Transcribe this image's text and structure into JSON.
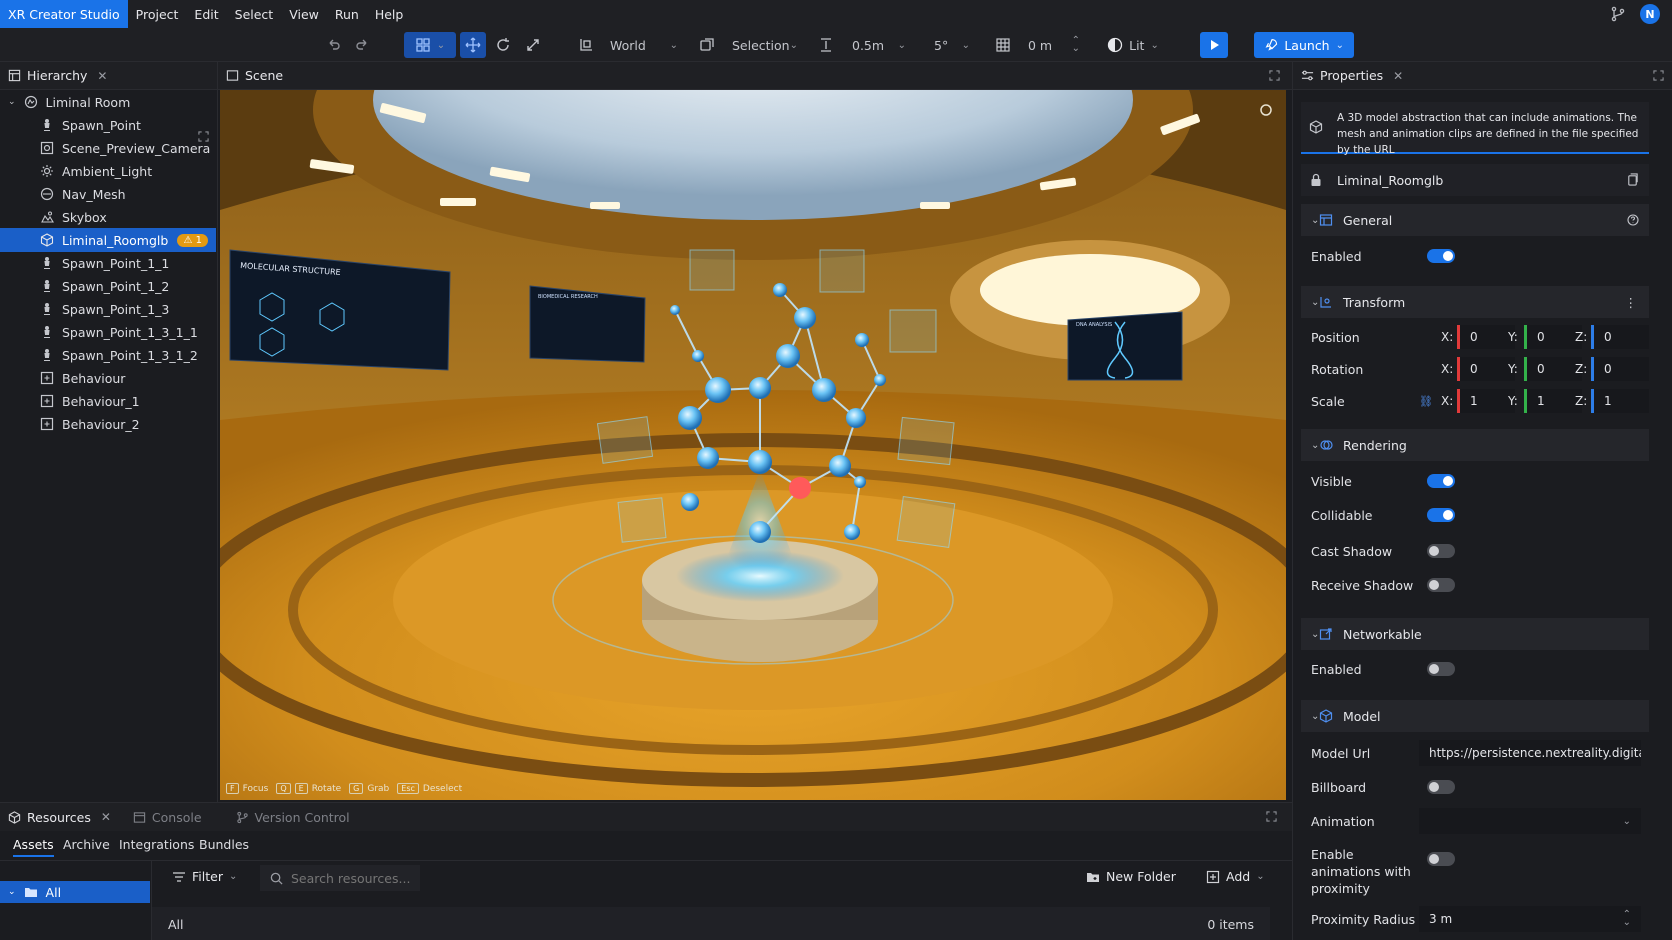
{
  "menubar": {
    "app_title": "XR Creator Studio",
    "items": [
      "Project",
      "Edit",
      "Select",
      "View",
      "Run",
      "Help"
    ],
    "avatar_initial": "N"
  },
  "toolbar": {
    "space_label": "World",
    "selection_label": "Selection",
    "translate_snap": "0.5m",
    "rotate_snap": "5°",
    "grid_height": "0 m",
    "render_mode": "Lit",
    "launch_label": "Launch"
  },
  "hierarchy": {
    "tab_label": "Hierarchy",
    "root": "Liminal Room",
    "items": [
      {
        "label": "Spawn_Point",
        "icon": "spawn-icon"
      },
      {
        "label": "Scene_Preview_Camera",
        "icon": "camera-icon"
      },
      {
        "label": "Ambient_Light",
        "icon": "sun-icon"
      },
      {
        "label": "Nav_Mesh",
        "icon": "navmesh-icon"
      },
      {
        "label": "Skybox",
        "icon": "skybox-icon"
      },
      {
        "label": "Liminal_Roomglb",
        "icon": "model-icon",
        "selected": true,
        "badge": "1"
      },
      {
        "label": "Spawn_Point_1_1",
        "icon": "spawn-icon"
      },
      {
        "label": "Spawn_Point_1_2",
        "icon": "spawn-icon"
      },
      {
        "label": "Spawn_Point_1_3",
        "icon": "spawn-icon"
      },
      {
        "label": "Spawn_Point_1_3_1_1",
        "icon": "spawn-icon"
      },
      {
        "label": "Spawn_Point_1_3_1_2",
        "icon": "spawn-icon"
      },
      {
        "label": "Behaviour",
        "icon": "behaviour-icon"
      },
      {
        "label": "Behaviour_1",
        "icon": "behaviour-icon"
      },
      {
        "label": "Behaviour_2",
        "icon": "behaviour-icon"
      }
    ]
  },
  "scene": {
    "tab_label": "Scene",
    "screen_left_title": "MOLECULAR STRUCTURE",
    "screen_mid_title": "BIOMEDICAL RESEARCH",
    "screen_right_title": "DNA ANALYSIS",
    "hints": [
      {
        "key": "F",
        "label": "Focus"
      },
      {
        "key": "Q",
        "label": ""
      },
      {
        "key": "E",
        "label": "Rotate"
      },
      {
        "key": "G",
        "label": "Grab"
      },
      {
        "key": "Esc",
        "label": "Deselect"
      }
    ]
  },
  "properties": {
    "tab_label": "Properties",
    "description": "A 3D model abstraction that can include animations. The mesh and animation clips are defined in the file specified by the URL",
    "node_name": "Liminal_Roomglb",
    "general": {
      "title": "General",
      "enabled_label": "Enabled",
      "enabled": true
    },
    "transform": {
      "title": "Transform",
      "position_label": "Position",
      "position": {
        "x": "0",
        "y": "0",
        "z": "0"
      },
      "rotation_label": "Rotation",
      "rotation": {
        "x": "0",
        "y": "0",
        "z": "0"
      },
      "scale_label": "Scale",
      "scale": {
        "x": "1",
        "y": "1",
        "z": "1"
      },
      "axis_x": "X:",
      "axis_y": "Y:",
      "axis_z": "Z:"
    },
    "rendering": {
      "title": "Rendering",
      "visible_label": "Visible",
      "visible": true,
      "collidable_label": "Collidable",
      "collidable": true,
      "cast_shadow_label": "Cast Shadow",
      "cast_shadow": false,
      "receive_shadow_label": "Receive Shadow",
      "receive_shadow": false
    },
    "networkable": {
      "title": "Networkable",
      "enabled_label": "Enabled",
      "enabled": false
    },
    "model": {
      "title": "Model",
      "url_label": "Model Url",
      "url_value": "https://persistence.nextreality.digital/",
      "billboard_label": "Billboard",
      "billboard": false,
      "animation_label": "Animation",
      "animation_value": "",
      "proximity_anim_label": "Enable animations with proximity",
      "proximity_anim": false,
      "proximity_radius_label": "Proximity Radius",
      "proximity_radius": "3 m"
    }
  },
  "resources": {
    "tabs": [
      "Resources",
      "Console",
      "Version Control"
    ],
    "subtabs": [
      "Assets",
      "Archive",
      "Integrations",
      "Bundles"
    ],
    "tree_all": "All",
    "filter_label": "Filter",
    "search_placeholder": "Search resources...",
    "new_folder_label": "New Folder",
    "add_label": "Add",
    "footer_label": "All",
    "item_count": "0 items"
  },
  "colors": {
    "accent": "#1a73e8",
    "warning": "#e39a12",
    "axis_x": "#e23a3a",
    "axis_y": "#33b24a",
    "axis_z": "#2d7de8"
  }
}
